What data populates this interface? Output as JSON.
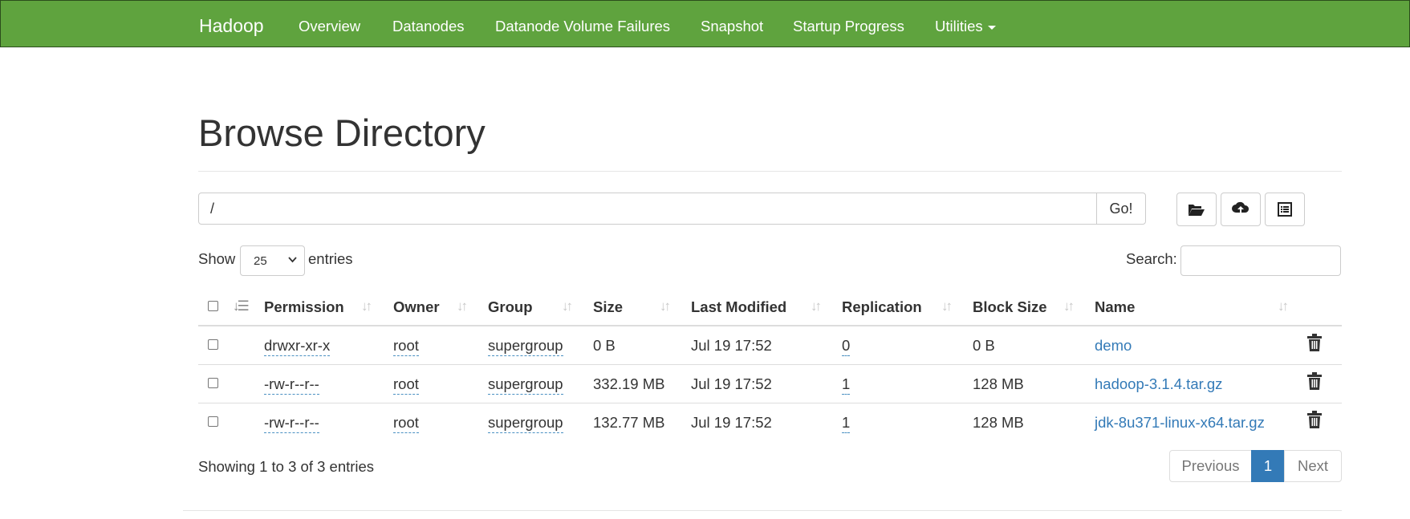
{
  "navbar": {
    "brand": "Hadoop",
    "items": [
      "Overview",
      "Datanodes",
      "Datanode Volume Failures",
      "Snapshot",
      "Startup Progress",
      "Utilities"
    ]
  },
  "page": {
    "title": "Browse Directory"
  },
  "path": {
    "value": "/",
    "go_label": "Go!"
  },
  "toolbar": {
    "icons": [
      "folder-open-icon",
      "cloud-upload-icon",
      "list-alt-icon"
    ]
  },
  "table_controls": {
    "show_label": "Show",
    "page_size": "25",
    "entries_label": "entries",
    "search_label": "Search:"
  },
  "table": {
    "columns": [
      "Permission",
      "Owner",
      "Group",
      "Size",
      "Last Modified",
      "Replication",
      "Block Size",
      "Name"
    ],
    "rows": [
      {
        "permission": "drwxr-xr-x",
        "owner": "root",
        "group": "supergroup",
        "size": "0 B",
        "modified": "Jul 19 17:52",
        "replication": "0",
        "block_size": "0 B",
        "name": "demo"
      },
      {
        "permission": "-rw-r--r--",
        "owner": "root",
        "group": "supergroup",
        "size": "332.19 MB",
        "modified": "Jul 19 17:52",
        "replication": "1",
        "block_size": "128 MB",
        "name": "hadoop-3.1.4.tar.gz"
      },
      {
        "permission": "-rw-r--r--",
        "owner": "root",
        "group": "supergroup",
        "size": "132.77 MB",
        "modified": "Jul 19 17:52",
        "replication": "1",
        "block_size": "128 MB",
        "name": "jdk-8u371-linux-x64.tar.gz"
      }
    ]
  },
  "footer": {
    "info": "Showing 1 to 3 of 3 entries",
    "previous": "Previous",
    "current_page": "1",
    "next": "Next"
  },
  "colors": {
    "navbar": "#5fa33e",
    "link": "#337ab7",
    "active_page": "#337ab7"
  }
}
